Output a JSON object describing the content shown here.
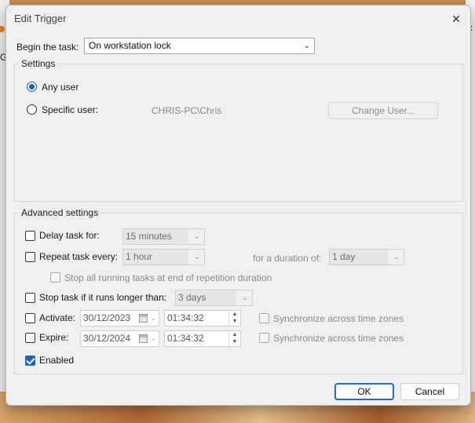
{
  "window": {
    "title": "Edit Trigger"
  },
  "background_side": {
    "letter": "G"
  },
  "begin": {
    "label": "Begin the task:",
    "value": "On workstation lock"
  },
  "settings": {
    "title": "Settings",
    "any_user_label": "Any user",
    "specific_user_label": "Specific user:",
    "specific_user_value": "CHRIS-PC\\Chris",
    "change_user_button": "Change User...",
    "selected": "any_user"
  },
  "advanced": {
    "title": "Advanced settings",
    "delay": {
      "label": "Delay task for:",
      "value": "15 minutes",
      "checked": false
    },
    "repeat": {
      "label": "Repeat task every:",
      "value": "1 hour",
      "checked": false,
      "duration_label": "for a duration of:",
      "duration_value": "1 day"
    },
    "stop_running": {
      "label": "Stop all running tasks at end of repetition duration",
      "checked": false
    },
    "stop_longer": {
      "label": "Stop task if it runs longer than:",
      "value": "3 days",
      "checked": false
    },
    "activate": {
      "label": "Activate:",
      "date": "30/12/2023",
      "time": "01:34:32",
      "sync_label": "Synchronize across time zones",
      "checked": false
    },
    "expire": {
      "label": "Expire:",
      "date": "30/12/2024",
      "time": "01:34:32",
      "sync_label": "Synchronize across time zones",
      "checked": false
    },
    "enabled": {
      "label": "Enabled",
      "checked": true
    }
  },
  "buttons": {
    "ok": "OK",
    "cancel": "Cancel"
  },
  "colors": {
    "accent": "#1f62c4",
    "dialog_bg": "#f0f0f0"
  }
}
